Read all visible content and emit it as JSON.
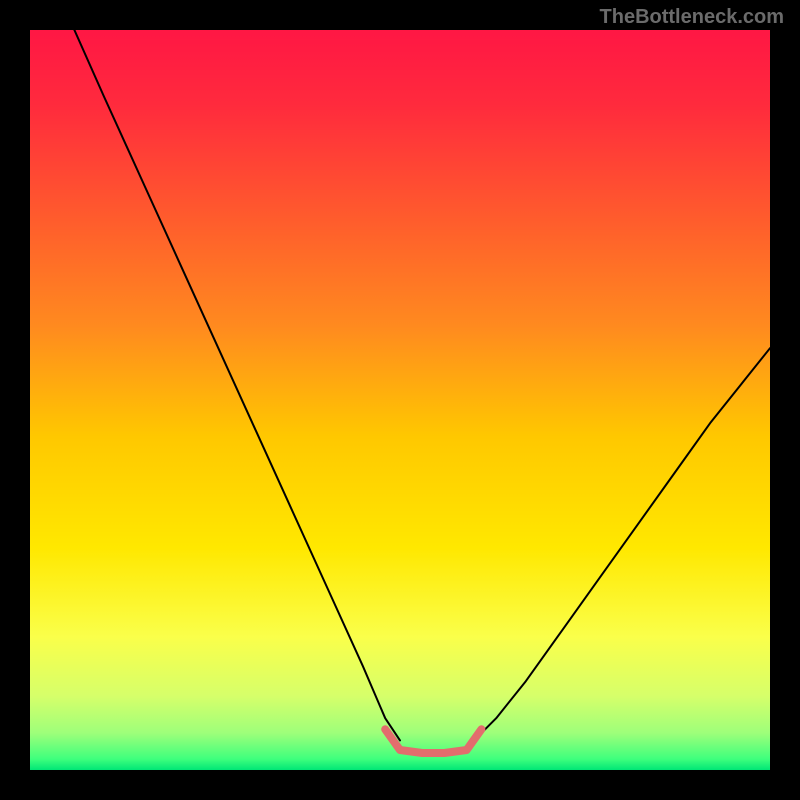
{
  "watermark": "TheBottleneck.com",
  "chart_data": {
    "type": "line",
    "title": "",
    "xlabel": "",
    "ylabel": "",
    "xlim": [
      0,
      100
    ],
    "ylim": [
      0,
      100
    ],
    "grid": false,
    "gradient_stops": [
      {
        "pos": 0.0,
        "color": "#ff1744"
      },
      {
        "pos": 0.1,
        "color": "#ff2a3d"
      },
      {
        "pos": 0.25,
        "color": "#ff5a2d"
      },
      {
        "pos": 0.4,
        "color": "#ff8a1f"
      },
      {
        "pos": 0.55,
        "color": "#ffc800"
      },
      {
        "pos": 0.7,
        "color": "#ffe800"
      },
      {
        "pos": 0.82,
        "color": "#faff4a"
      },
      {
        "pos": 0.9,
        "color": "#d6ff6a"
      },
      {
        "pos": 0.95,
        "color": "#9eff7a"
      },
      {
        "pos": 0.985,
        "color": "#3fff7d"
      },
      {
        "pos": 1.0,
        "color": "#00e676"
      }
    ],
    "series": [
      {
        "name": "left-curve",
        "color": "#000000",
        "width": 2,
        "x": [
          6,
          10,
          15,
          20,
          25,
          30,
          35,
          40,
          45,
          48,
          50
        ],
        "y": [
          100,
          91,
          80,
          69,
          58,
          47,
          36,
          25,
          14,
          7,
          4
        ]
      },
      {
        "name": "right-curve",
        "color": "#000000",
        "width": 2,
        "x": [
          60,
          63,
          67,
          72,
          77,
          82,
          87,
          92,
          96,
          100
        ],
        "y": [
          4,
          7,
          12,
          19,
          26,
          33,
          40,
          47,
          52,
          57
        ]
      },
      {
        "name": "bottom-flat",
        "color": "#e26d6d",
        "width": 8,
        "x": [
          48,
          50,
          53,
          56,
          59,
          61
        ],
        "y": [
          5.5,
          2.7,
          2.3,
          2.3,
          2.7,
          5.5
        ]
      }
    ]
  }
}
